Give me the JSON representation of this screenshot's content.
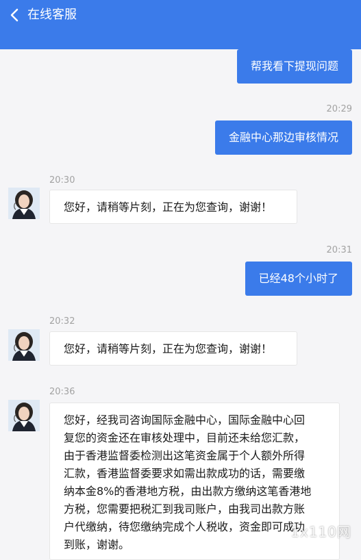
{
  "header": {
    "title": "在线客服",
    "bg": "#3b7bea"
  },
  "messages": [
    {
      "from": "user",
      "text": "帮我看下提现问题"
    },
    {
      "time": "20:29"
    },
    {
      "from": "user",
      "text": "金融中心那边审核情况"
    },
    {
      "time": "20:30"
    },
    {
      "from": "agent",
      "text": "您好，请稍等片刻，正在为您查询，谢谢！"
    },
    {
      "time": "20:31"
    },
    {
      "from": "user",
      "text": "已经48个小时了"
    },
    {
      "time": "20:32"
    },
    {
      "from": "agent",
      "text": "您好，请稍等片刻，正在为您查询，谢谢！"
    },
    {
      "time": "20:36"
    },
    {
      "from": "agent",
      "lines": [
        "您好，经我司咨询国际金融中心，国际金融中心回",
        "复您的资金还在审核处理中，目前还未给您汇款，",
        "由于香港监督委检测出这笔资金属于个人额外所得",
        "汇款，香港监督委要求如需出款成功的话，需要缴",
        "纳本金8%的香港地方税，由出款方缴纳这笔香港地",
        "方税，您需要把税汇到我司账户，由我司出款方账",
        "户代缴纳，待您缴纳完成个人税收，资金即可成功",
        "到账，谢谢。"
      ]
    }
  ],
  "watermark": "1x110网"
}
